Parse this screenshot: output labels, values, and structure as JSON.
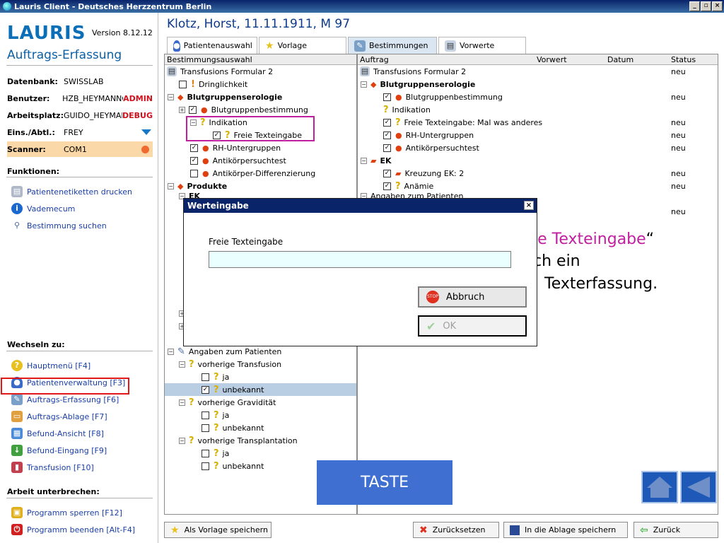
{
  "window": {
    "title": "Lauris Client - Deutsches Herzzentrum Berlin"
  },
  "sidebar": {
    "logo": "LAURIS",
    "version": "Version 8.12.12",
    "title": "Auftrags-Erfassung",
    "info": [
      {
        "label": "Datenbank:",
        "value": "SWISSLAB",
        "flag": ""
      },
      {
        "label": "Benutzer:",
        "value": "HZB_HEYMANNG",
        "flag": "ADMIN"
      },
      {
        "label": "Arbeitsplatz:",
        "value": "GUIDO_HEYMAN",
        "flag": "DEBUG"
      },
      {
        "label": "Eins./Abtl.:",
        "value": "FREY",
        "flag": ""
      },
      {
        "label": "Scanner:",
        "value": "COM1",
        "flag": ""
      }
    ],
    "funktionen_header": "Funktionen:",
    "funktionen": [
      "Patientenetiketten drucken",
      "Vademecum",
      "Bestimmung suchen"
    ],
    "wechseln_header": "Wechseln zu:",
    "wechseln": [
      "Hauptmenü [F4]",
      "Patientenverwaltung [F3]",
      "Auftrags-Erfassung [F6]",
      "Auftrags-Ablage [F7]",
      "Befund-Ansicht [F8]",
      "Befund-Eingang [F9]",
      "Transfusion [F10]"
    ],
    "arbeit_header": "Arbeit unterbrechen:",
    "arbeit": [
      "Programm sperren [F12]",
      "Programm beenden [Alt-F4]"
    ]
  },
  "patient": {
    "header": "Klotz, Horst, 11.11.1911, M 97"
  },
  "tabs": [
    "Patientenauswahl",
    "Vorlage",
    "Bestimmungen",
    "Vorwerte"
  ],
  "left_panel": {
    "header": "Bestimmungsauswahl",
    "rows": [
      "Transfusions Formular 2",
      "Dringlichkeit",
      "Blutgruppenserologie",
      "Blutgruppenbestimmung",
      "Indikation",
      "Freie Texteingabe",
      "RH-Untergruppen",
      "Antikörpersuchtest",
      "Antikörper-Differenzierung",
      "Produkte",
      "EK",
      "Angaben zum Patienten",
      "vorherige Transfusion",
      "ja",
      "unbekannt",
      "vorherige Gravidität",
      "ja",
      "unbekannt",
      "vorherige Transplantation",
      "ja",
      "unbekannt"
    ]
  },
  "right_panel": {
    "headers": [
      "Auftrag",
      "Vorwert",
      "Datum",
      "Status"
    ],
    "rows": [
      {
        "name": "Transfusions Formular 2",
        "status": "neu"
      },
      {
        "name": "Blutgruppenserologie",
        "status": ""
      },
      {
        "name": "Blutgruppenbestimmung",
        "status": "neu"
      },
      {
        "name": "Indikation",
        "status": ""
      },
      {
        "name": "Freie Texteingabe: Mal was anderes",
        "status": "neu"
      },
      {
        "name": "RH-Untergruppen",
        "status": "neu"
      },
      {
        "name": "Antikörpersuchtest",
        "status": "neu"
      },
      {
        "name": "EK",
        "status": ""
      },
      {
        "name": "Kreuzung EK: 2",
        "status": "neu"
      },
      {
        "name": "Anämie",
        "status": "neu"
      },
      {
        "name": "Angaben zum Patienten",
        "status": ""
      },
      {
        "name": "",
        "status": "neu"
      }
    ]
  },
  "overlay": {
    "line1_colored": "ie Texteingabe",
    "line1_quote": "“",
    "line2": "ch ein",
    "line3": "Texterfassung."
  },
  "dialog": {
    "title": "Werteingabe",
    "label": "Freie Texteingabe",
    "input_value": "",
    "cancel_label": "Abbruch",
    "ok_label": "OK",
    "close": "×"
  },
  "taste": "TASTE",
  "footer": {
    "save_template": "Als Vorlage speichern",
    "reset": "Zurücksetzen",
    "save_storage": "In die Ablage speichern",
    "back": "Zurück"
  },
  "colors": {
    "accent": "#0b6fb8",
    "title_bar": "#0a246a",
    "highlight_red": "#e01818",
    "highlight_magenta": "#c020a0",
    "taste": "#3e6fd1"
  }
}
